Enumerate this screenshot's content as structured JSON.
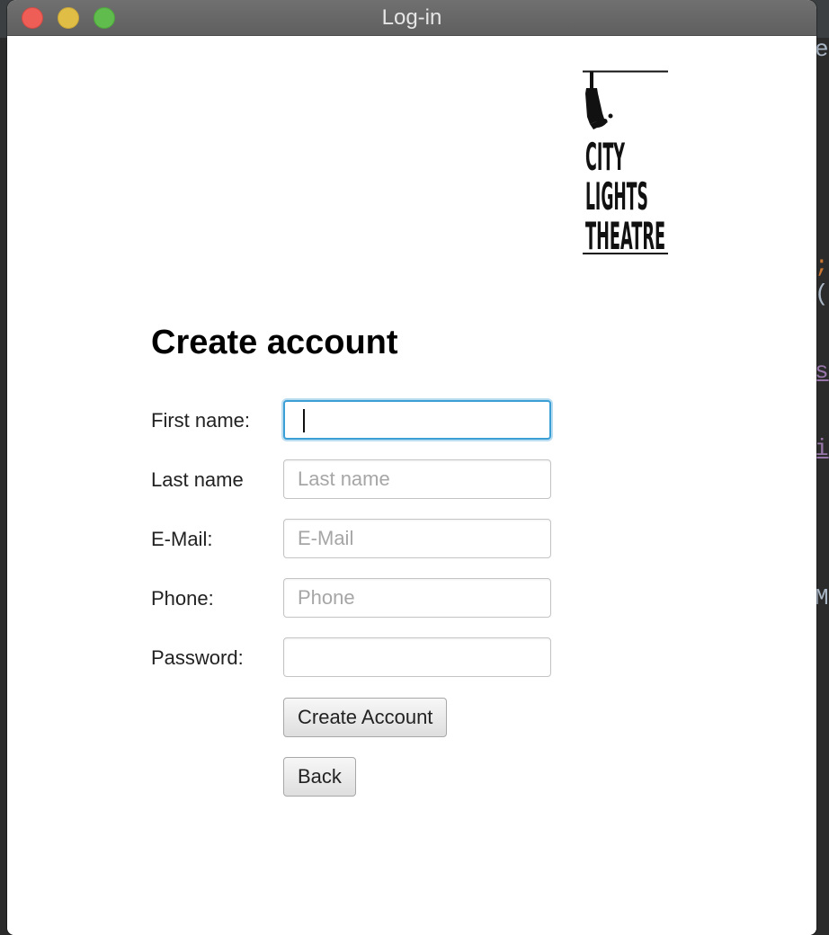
{
  "window": {
    "title": "Log-in"
  },
  "logo": {
    "lines": [
      "CITY",
      "LIGHTS",
      "THEATRE"
    ]
  },
  "form": {
    "heading": "Create account",
    "fields": [
      {
        "label": "First name:",
        "value": "",
        "placeholder": ""
      },
      {
        "label": "Last name",
        "value": "",
        "placeholder": "Last name"
      },
      {
        "label": "E-Mail:",
        "value": "",
        "placeholder": "E-Mail"
      },
      {
        "label": "Phone:",
        "value": "",
        "placeholder": "Phone"
      },
      {
        "label": "Password:",
        "value": "",
        "placeholder": ""
      }
    ],
    "create_button_label": "Create Account",
    "back_button_label": "Back"
  },
  "background_editor": {
    "fragments": [
      "e",
      ";",
      "(",
      "s",
      "i",
      "M"
    ]
  },
  "colors": {
    "focus_ring": "#3b9fd6",
    "close": "#ee5e57",
    "minimize": "#e0bd45",
    "maximize": "#5fbc4d"
  }
}
